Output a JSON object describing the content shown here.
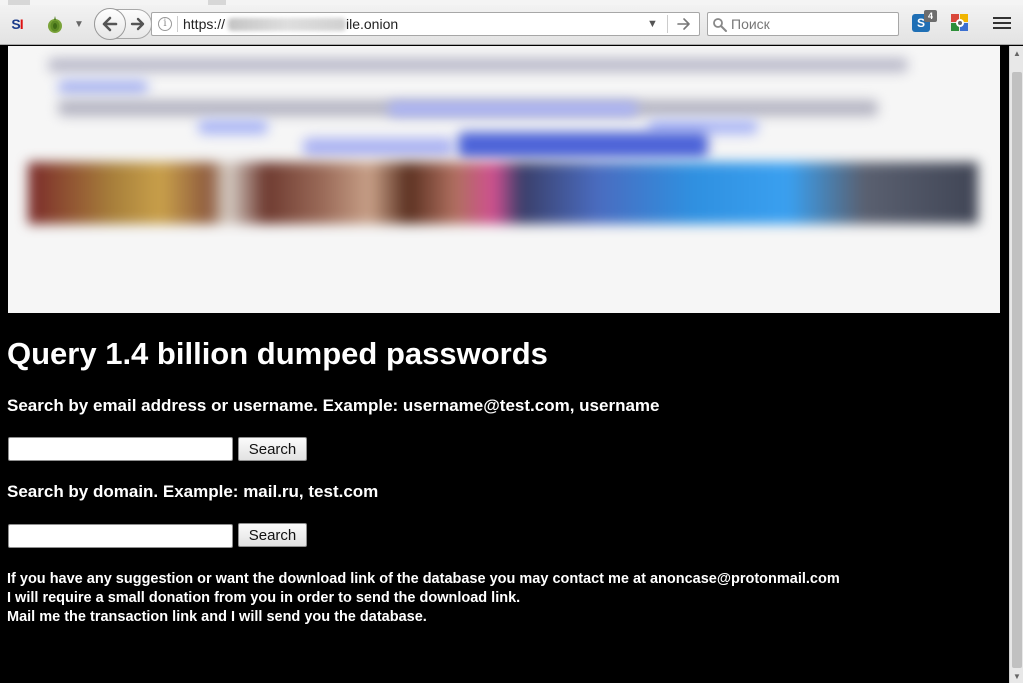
{
  "browser": {
    "url_prefix": "https://",
    "url_suffix": "ile.onion",
    "search_placeholder": "Поиск",
    "extension_badge": "4",
    "extension_letter": "S"
  },
  "page": {
    "title": "Query 1.4 billion dumped passwords",
    "email_search_label": "Search by email address or username. Example: username@test.com, username",
    "domain_search_label": "Search by domain. Example: mail.ru, test.com",
    "search_button_label": "Search",
    "email_search_value": "",
    "domain_search_value": "",
    "note_line_1": "If you have any suggestion or want the download link of the database you may contact me at anoncase@protonmail.com",
    "note_line_2": "I will require a small donation from you in order to send the download link.",
    "note_line_3": "Mail me the transaction link and I will send you the database."
  },
  "icons": [
    "si-icon",
    "onion-icon",
    "dropdown-icon",
    "back-icon",
    "forward-icon",
    "info-icon",
    "go-arrow-icon",
    "search-icon",
    "extension-icon",
    "gear-extension-icon",
    "hamburger-menu-icon"
  ],
  "colors": {
    "page_background": "#000000",
    "text": "#ffffff",
    "banner_background": "#f6f6f6"
  }
}
